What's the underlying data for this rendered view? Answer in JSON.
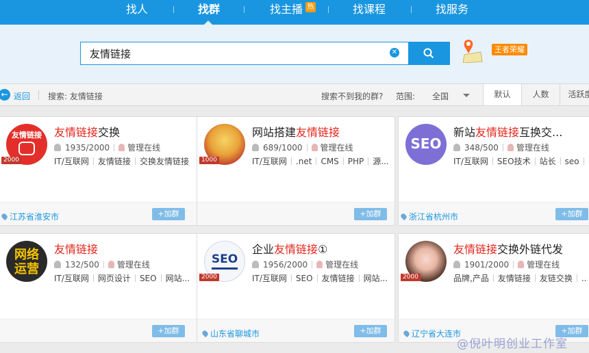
{
  "nav": {
    "items": [
      "找人",
      "找群",
      "找主播",
      "找课程",
      "找服务"
    ],
    "hot_badge": "热"
  },
  "search": {
    "value": "友情链接",
    "clear_icon": "clear-icon",
    "button_icon": "search-icon"
  },
  "promo": {
    "icon": "map-pin-icon",
    "badge": "王者荣耀"
  },
  "filter": {
    "back": "返回",
    "search_label": "搜索: 友情链接",
    "not_found": "搜索不到我的群?",
    "range_label": "范围:",
    "range_value": "全国",
    "sort_tabs": [
      "默认",
      "人数",
      "活跃度"
    ]
  },
  "colors": {
    "accent": "#1a96e0",
    "highlight": "#e3231a",
    "join": "#7fbce8",
    "badge": "#ff8a00"
  },
  "cards": [
    {
      "title_pre": "",
      "title_hl": "友情链接",
      "title_post": "交换",
      "members": "1935/2000",
      "admin": "管理在线",
      "tags": [
        "IT/互联网",
        "友情链接",
        "交换友情链接"
      ],
      "location": "江苏省淮安市",
      "join": "+加群",
      "tag": "2000",
      "avatar": "friendship-link-avatar",
      "avatar_text": "友情链接"
    },
    {
      "title_pre": "网站搭建",
      "title_hl": "友情链接",
      "title_post": "",
      "members": "689/1000",
      "admin": "管理在线",
      "tags": [
        "IT/互联网",
        ".net",
        "CMS",
        "PHP",
        "源..."
      ],
      "location": "",
      "join": "+加群",
      "tag": "1000",
      "avatar": "lantern-avatar",
      "avatar_text": ""
    },
    {
      "title_pre": "新站",
      "title_hl": "友情链接",
      "title_post": "互换交...",
      "members": "348/500",
      "admin": "管理在线",
      "tags": [
        "IT/互联网",
        "SEO技术",
        "站长",
        "seo",
        "..."
      ],
      "location": "浙江省杭州市",
      "join": "+加群",
      "tag": "",
      "avatar": "seo-avatar",
      "avatar_text": "SEO"
    },
    {
      "title_pre": "",
      "title_hl": "友情链接",
      "title_post": "",
      "members": "132/500",
      "admin": "管理在线",
      "tags": [
        "IT/互联网",
        "网页设计",
        "SEO",
        "网站..."
      ],
      "location": "",
      "join": "+加群",
      "tag": "",
      "avatar": "network-ops-avatar",
      "avatar_text": "网络运营"
    },
    {
      "title_pre": "企业",
      "title_hl": "友情链接",
      "title_post": "①",
      "members": "1956/2000",
      "admin": "管理在线",
      "tags": [
        "IT/互联网",
        "SEO",
        "友情链接",
        "网站..."
      ],
      "location": "山东省聊城市",
      "join": "+加群",
      "tag": "2000",
      "avatar": "seo-engine-avatar",
      "avatar_text": "SEO"
    },
    {
      "title_pre": "",
      "title_hl": "友情链接",
      "title_post": "交换外链代发",
      "members": "1901/2000",
      "admin": "管理在线",
      "tags": [
        "品牌,产品",
        "友情链接",
        "友链交换",
        "..."
      ],
      "location": "辽宁省大连市",
      "join": "+加群",
      "tag": "2000",
      "avatar": "girl-photo-avatar",
      "avatar_text": ""
    }
  ],
  "watermark": "@倪叶明创业工作室"
}
